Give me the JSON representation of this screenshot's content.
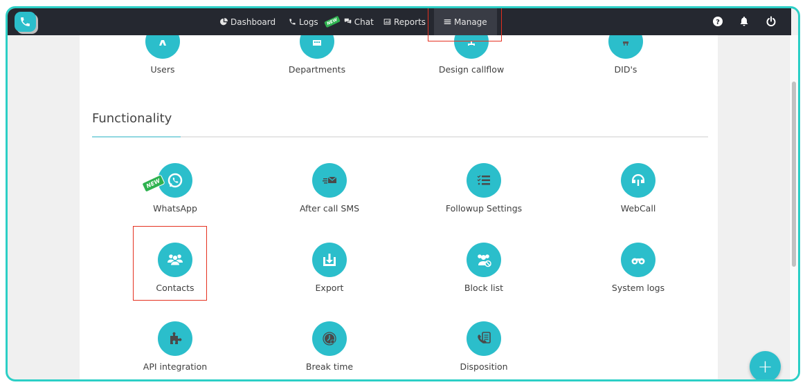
{
  "app": {
    "logo_icon": "phone-icon"
  },
  "nav": {
    "items": [
      {
        "label": "Dashboard",
        "icon": "pie-chart-icon"
      },
      {
        "label": "Logs",
        "icon": "phone-icon"
      },
      {
        "label": "Chat",
        "icon": "chat-icon",
        "badge": "NEW"
      },
      {
        "label": "Reports",
        "icon": "bar-chart-icon"
      },
      {
        "label": "Manage",
        "icon": "menu-icon",
        "active": true
      }
    ]
  },
  "top_icons": [
    {
      "name": "help",
      "icon": "question-circle-icon"
    },
    {
      "name": "notifications",
      "icon": "bell-icon"
    },
    {
      "name": "logout",
      "icon": "power-icon"
    }
  ],
  "top_row": [
    {
      "label": "Users",
      "icon": "users-icon"
    },
    {
      "label": "Departments",
      "icon": "building-icon"
    },
    {
      "label": "Design callflow",
      "icon": "sitemap-icon"
    },
    {
      "label": "DID's",
      "icon": "numbers-icon"
    }
  ],
  "section": {
    "title": "Functionality"
  },
  "functionality": [
    {
      "label": "WhatsApp",
      "icon": "whatsapp-icon",
      "badge": "NEW"
    },
    {
      "label": "After call SMS",
      "icon": "fast-mail-icon"
    },
    {
      "label": "Followup Settings",
      "icon": "checklist-icon"
    },
    {
      "label": "WebCall",
      "icon": "headset-icon"
    },
    {
      "label": "Contacts",
      "icon": "contacts-icon"
    },
    {
      "label": "Export",
      "icon": "download-icon"
    },
    {
      "label": "Block list",
      "icon": "block-users-icon"
    },
    {
      "label": "System logs",
      "icon": "binoculars-icon"
    },
    {
      "label": "API integration",
      "icon": "puzzle-icon"
    },
    {
      "label": "Break time",
      "icon": "clock-icon"
    },
    {
      "label": "Disposition",
      "icon": "phone-document-icon"
    }
  ],
  "fab": {
    "label": "+"
  },
  "colors": {
    "accent": "#2bbecb",
    "frame": "#2ccfc6",
    "topbar": "#252830",
    "highlight": "#e5301f",
    "new_badge": "#2eb24f"
  }
}
